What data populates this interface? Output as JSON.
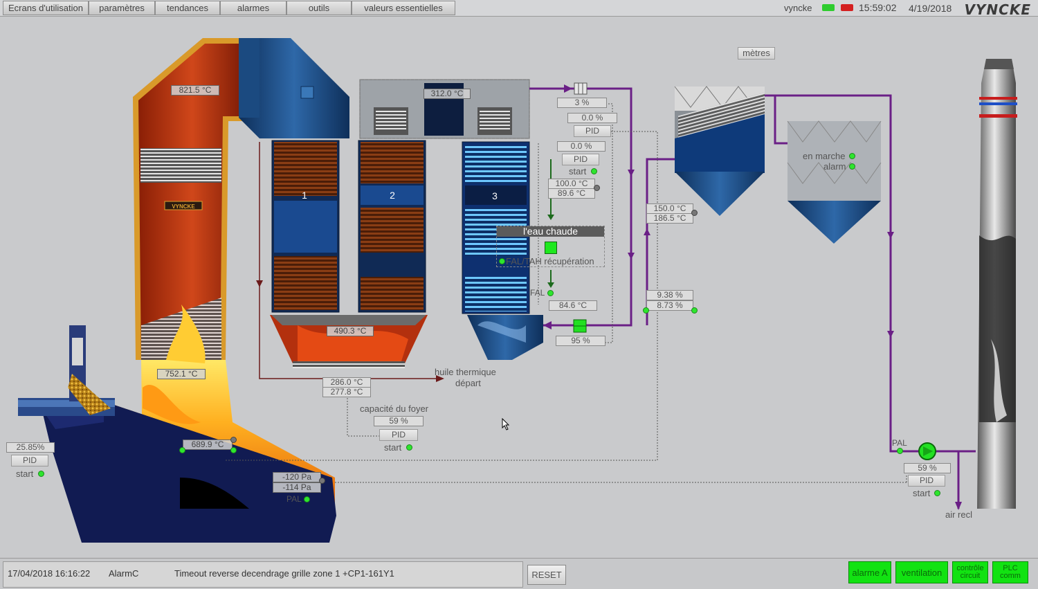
{
  "menu": {
    "tabs": [
      "Ecrans d'utilisation",
      "paramètres",
      "tendances",
      "alarmes",
      "outils",
      "valeurs essentielles"
    ],
    "user": "vyncke",
    "time": "15:59:02",
    "date": "4/19/2018",
    "brand": "VYNCKE"
  },
  "units_button": "mètres",
  "furnace": {
    "temp_top": "821.5 °C",
    "temp_lower": "752.1 °C",
    "temp_grate": "689.9 °C",
    "pressure_1": "-120 Pa",
    "pressure_2": "-114 Pa",
    "pal_label": "PAL",
    "plate": "VYNCKE"
  },
  "feeder": {
    "value": "25.85%",
    "pid_label": "PID",
    "start_label": "start"
  },
  "exchangers": {
    "labels": [
      "1",
      "2",
      "3"
    ],
    "top_temp": "312.0 °C",
    "hopper_temp": "490.3 °C"
  },
  "thermal_oil": {
    "temp_1": "286.0 °C",
    "temp_2": "277.8 °C",
    "label_line1": "huile thermique",
    "label_line2": "départ"
  },
  "capacity": {
    "label": "capacité du foyer",
    "value": "59 %",
    "pid_label": "PID",
    "start_label": "start"
  },
  "valve_top": {
    "value": "3 %",
    "setpoint": "0.0 %",
    "pid_label": "PID"
  },
  "hot_water_ctrl": {
    "setpoint": "0.0 %",
    "pid_label": "PID",
    "start_label": "start",
    "temp_1": "100.0 °C",
    "temp_2": "89.6 °C",
    "fal_label": "FAL",
    "fal_temp": "84.6 °C",
    "bottom_value": "95 %"
  },
  "hot_water": {
    "title": "l'eau chaude",
    "status_label": "FAL/TAH récupération"
  },
  "flue": {
    "temp_1": "150.0 °C",
    "temp_2": "186.5 °C",
    "pct_1": "9.38 %",
    "pct_2": "8.73 %"
  },
  "filter": {
    "running_label": "en marche",
    "alarm_label": "alarm"
  },
  "fan": {
    "pal_label": "PAL",
    "value": "59 %",
    "pid_label": "PID",
    "start_label": "start",
    "air_label": "air recl"
  },
  "alarm": {
    "datetime": "17/04/2018 16:16:22",
    "source": "AlarmC",
    "message": "Timeout reverse decendrage grille zone 1 +CP1-161Y1",
    "reset_label": "RESET"
  },
  "status_buttons": [
    "alarme A",
    "ventilation",
    "contrôle circuit",
    "PLC comm"
  ],
  "colors": {
    "pipe_purple": "#6a1f86",
    "status_green": "#12e212",
    "steel_blue": "#1e4f86"
  }
}
